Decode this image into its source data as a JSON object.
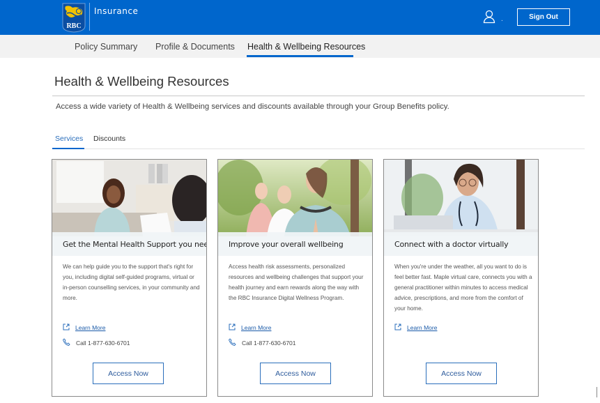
{
  "header": {
    "brand_text": "Insurance",
    "logo_label": "RBC",
    "user_menu_dot": ".",
    "sign_out_label": "Sign Out",
    "colors": {
      "primary": "#0066cc",
      "nav_bg": "#f2f2f2",
      "link": "#1a5aa8",
      "logo_yellow": "#f2c200"
    }
  },
  "nav": {
    "items": [
      {
        "label": "Policy Summary",
        "active": false
      },
      {
        "label": "Profile & Documents",
        "active": false
      },
      {
        "label": "Health & Wellbeing Resources",
        "active": true
      }
    ]
  },
  "page": {
    "title": "Health & Wellbeing Resources",
    "intro": "Access a wide variety of Health & Wellbeing services and discounts available through your Group Benefits policy."
  },
  "subtabs": [
    {
      "label": "Services",
      "active": true
    },
    {
      "label": "Discounts",
      "active": false
    }
  ],
  "cards": [
    {
      "image": "counselling-session-photo",
      "title": "Get the Mental Health Support you need",
      "description": "We can help guide you to the support that's right for you, including digital self-guided programs, virtual or in-person counselling services, in your community and more.",
      "learn_more": "Learn More",
      "phone": "Call 1-877-630-6701",
      "cta": "Access Now"
    },
    {
      "image": "outdoor-yoga-photo",
      "title": "Improve your overall wellbeing",
      "description": "Access health risk assessments, personalized resources and wellbeing challenges that support your health journey and earn rewards along the way with the RBC Insurance Digital Wellness Program.",
      "learn_more": "Learn More",
      "phone": "Call 1-877-630-6701",
      "cta": "Access Now"
    },
    {
      "image": "virtual-doctor-photo",
      "title": "Connect with a doctor virtually",
      "description": "When you're under the weather, all you want to do is feel better fast. Maple virtual care, connects you with a general practitioner within minutes to access medical advice, prescriptions, and more from the comfort of your home.",
      "learn_more": "Learn More",
      "phone": null,
      "cta": "Access Now"
    }
  ]
}
